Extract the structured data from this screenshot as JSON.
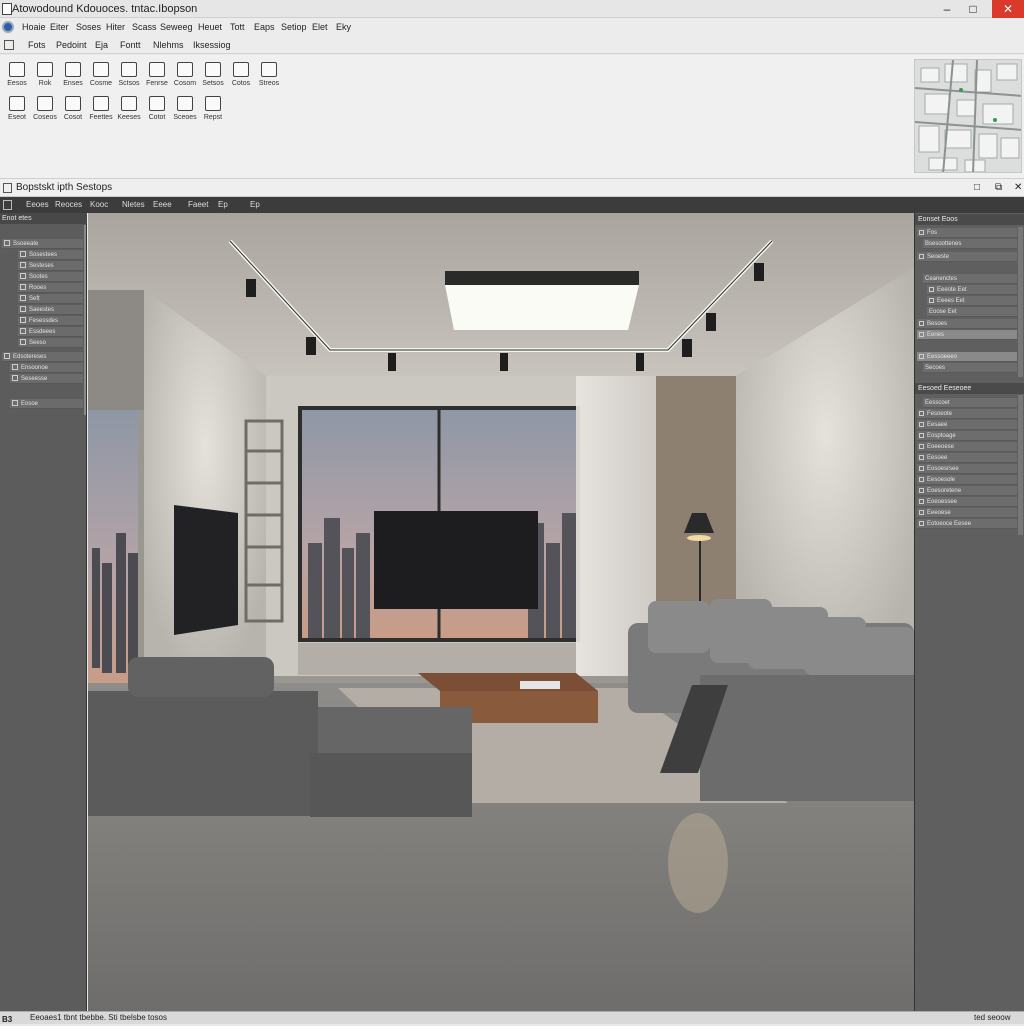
{
  "window": {
    "title": "Atowodound Kdouoces. tntac.Ibopson",
    "minimize_glyph": "–",
    "maximize_glyph": "□",
    "close_glyph": "✕"
  },
  "menubar": {
    "items": [
      "Hoaie",
      "Eiter",
      "Soses",
      "Hiter",
      "Scass",
      "Seweeg",
      "Heuet",
      "Tott",
      "Eaps",
      "Setiop",
      "Elet",
      "Eky"
    ]
  },
  "ribbon_tabs": {
    "items": [
      "Fots",
      "Pedoint",
      "Eja",
      "Fontt",
      "Nlehms",
      "Iksessiog"
    ]
  },
  "ribbon": {
    "row1": [
      "Eesos",
      "Rok",
      "Enses",
      "Cosme",
      "Sctsos",
      "Fenrse",
      "Cosom",
      "Setsos",
      "Cotos",
      "Streos"
    ],
    "row2": [
      "Eseot",
      "Coseos",
      "Cosot",
      "Feettes",
      "Keeses",
      "Cotot",
      "Sceoes",
      "Repst"
    ]
  },
  "document": {
    "title": "Bopstskt ipth Sestops",
    "btn_min": "□",
    "btn_restore": "⧉",
    "btn_close": "✕"
  },
  "viewport_toolbar": {
    "items": [
      "Eeoes",
      "Reoces",
      "Kooc",
      "Nletes",
      "Eeee",
      "Faeet",
      "Ep",
      "Ep"
    ]
  },
  "left_panel": {
    "header": "Enot etes",
    "rows": [
      "Ssoeeate",
      "Sosestees",
      "Sesteses",
      "Sootes",
      "Rooes",
      "Seft",
      "Saeestes",
      "Fesessdes",
      "Essdeees",
      "Seeso",
      "Edsotereses",
      "Ensoonoe",
      "Seseesse",
      "Eosoe"
    ]
  },
  "right_panel": {
    "section1_header": "Eonset Eoos",
    "section1_rows": [
      "Fos",
      "Bsesoottenes",
      "Seoeste",
      "Ceanenctes",
      "Eeeote  Eet",
      "Eeees  Eet",
      "Eoose  Eet",
      "Besoes",
      "Eenes",
      "Eessoeeeo",
      "Secoes"
    ],
    "section2_header": "Eesoed Eeseoee",
    "section2_rows": [
      "Eesscoet",
      "Fesoeote",
      "Eesaee",
      "Eosptoage",
      "Eoeeoese",
      "Eesoee",
      "Eosoesrsee",
      "Eesoesole",
      "Eoesoretene",
      "Eoeoessee",
      "Eeeoese",
      "Eotoeoce  Eesee"
    ]
  },
  "statusbar": {
    "icon": "B3",
    "left_text": "Eeoaes1 tbnt tbebbe. Sti tbelsbe tosos",
    "right_text": "ted seoow"
  },
  "colors": {
    "accent": "#2e5fa8",
    "close": "#d93a2b",
    "panel": "#5c5c5c"
  },
  "icons": [
    "app-icon",
    "logo-icon",
    "window-close-icon",
    "light-icon",
    "track-light-icon"
  ]
}
